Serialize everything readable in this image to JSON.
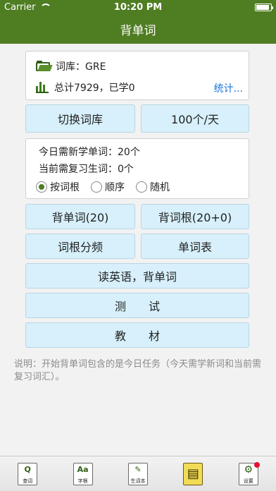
{
  "status_bar": {
    "carrier": "Carrier",
    "time": "10:20 PM",
    "battery_level": 0.9
  },
  "nav": {
    "title": "背单词"
  },
  "library": {
    "label": "词库：GRE",
    "stats": "总计7929，已学0",
    "stats_link": "统计..."
  },
  "buttons": {
    "switch_library": "切换词库",
    "daily_count": "100个/天",
    "memorize_words": "背单词(20)",
    "memorize_roots": "背词根(20+0)",
    "root_frequency": "词根分频",
    "word_list": "单词表",
    "read_english": "读英语，背单词",
    "test": "测　　试",
    "textbook": "教　　材"
  },
  "today": {
    "new_words": "今日需新学单词：20个",
    "review_words": "当前需复习生词：0个",
    "order_options": [
      {
        "label": "按词根",
        "selected": true
      },
      {
        "label": "顺序",
        "selected": false
      },
      {
        "label": "随机",
        "selected": false
      }
    ]
  },
  "note": "说明：开始背单词包含的是今日任务（今天需学新词和当前需复习词汇）。",
  "tabs": [
    {
      "label": "查词",
      "glyph": "Q",
      "icon": "search-book-icon",
      "active": false
    },
    {
      "label": "字根",
      "glyph": "Aa",
      "icon": "word-root-icon",
      "active": false
    },
    {
      "label": "生词本",
      "glyph": "✎",
      "icon": "notebook-icon",
      "active": false
    },
    {
      "label": "",
      "glyph": "▤",
      "icon": "study-book-icon",
      "active": true
    },
    {
      "label": "设置",
      "glyph": "⚙",
      "icon": "settings-icon",
      "active": false,
      "badge": true
    }
  ]
}
